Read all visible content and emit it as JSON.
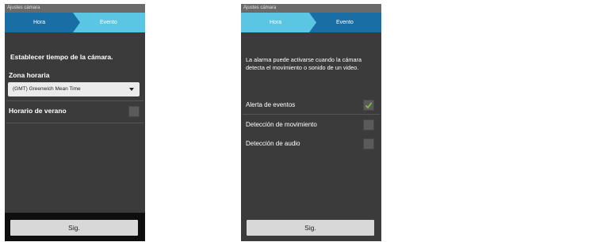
{
  "colors": {
    "tab_active": "#1a6ea6",
    "tab_inactive": "#5bc6e4",
    "background": "#3b3b3b",
    "check_mark": "#7ec63a"
  },
  "left_screen": {
    "status_bar": "Ajustes cámara",
    "tabs": [
      {
        "label": "Hora",
        "active": true
      },
      {
        "label": "Evento",
        "active": false
      }
    ],
    "section_title": "Establecer tiempo de la cámara.",
    "timezone_label": "Zona horaria",
    "timezone_value": "(GMT) Greenwich Mean Time",
    "dst_label": "Horario de verano",
    "dst_checked": false,
    "next_button": "Sig."
  },
  "right_screen": {
    "status_bar": "Ajustes cámara",
    "tabs": [
      {
        "label": "Hora",
        "active": false
      },
      {
        "label": "Evento",
        "active": true
      }
    ],
    "description": "La alarma puede activarse cuando la cámara detecta el movimiento o sonido de un video.",
    "options": [
      {
        "label": "Alerta de eventos",
        "checked": true
      },
      {
        "label": "Detección de movimiento",
        "checked": false
      },
      {
        "label": "Detección de audio",
        "checked": false
      }
    ],
    "next_button": "Sig."
  }
}
